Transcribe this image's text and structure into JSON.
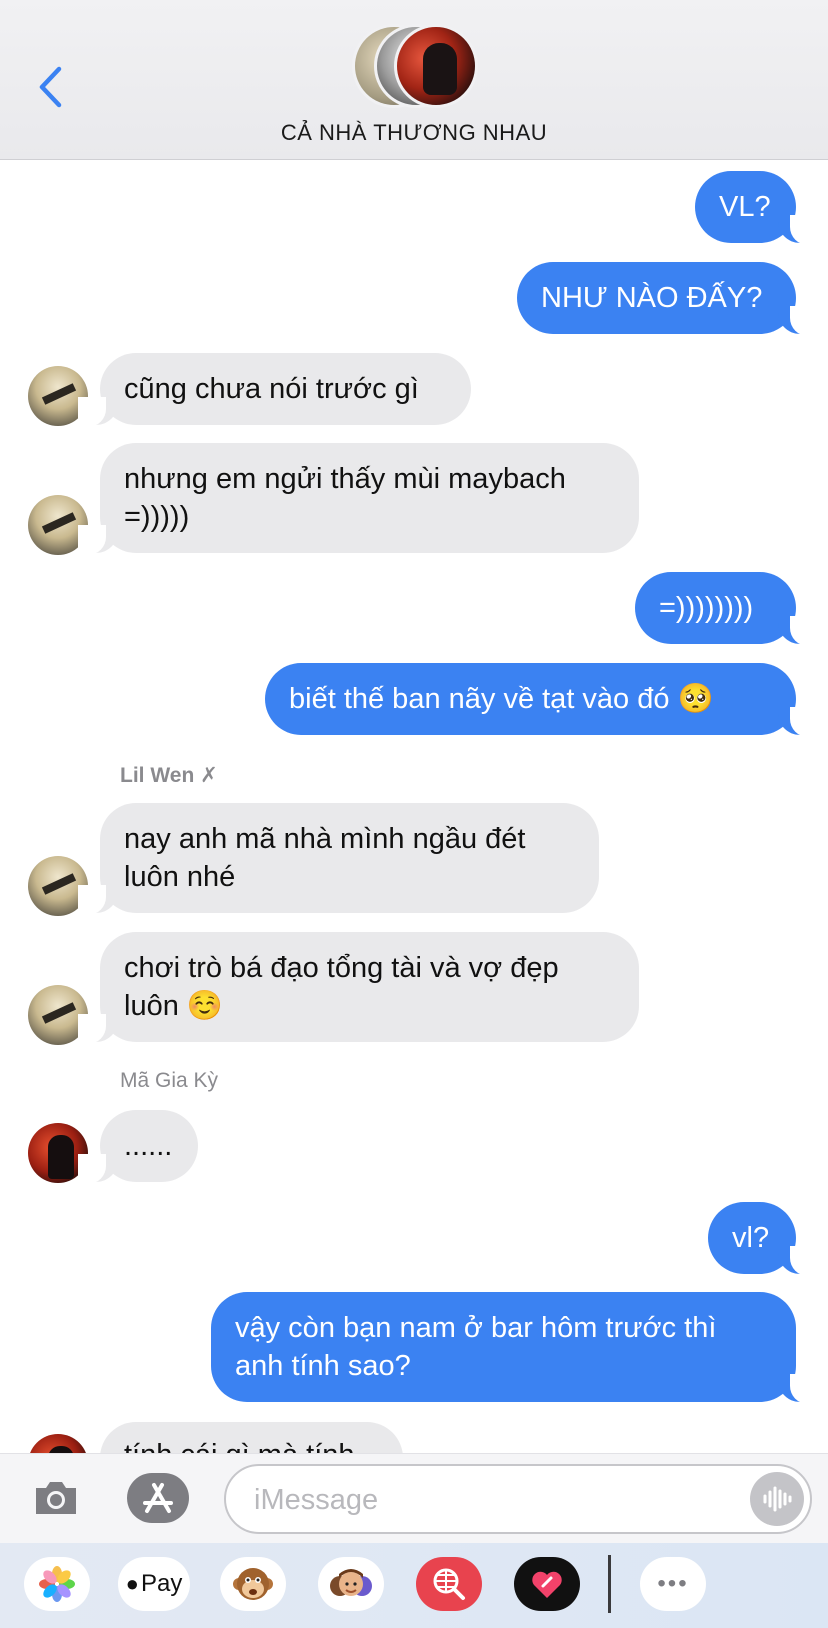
{
  "header": {
    "back_icon": "chevron-left-icon",
    "group_name": "CẢ NHÀ THƯƠNG NHAU",
    "accent_color": "#3b82f2"
  },
  "messages": [
    {
      "from": "me",
      "text": "VL?"
    },
    {
      "from": "me",
      "text": "NHƯ NÀO ĐẤY?"
    },
    {
      "from": "Lil Wen",
      "text": "cũng chưa nói trước gì"
    },
    {
      "from": "Lil Wen",
      "text_line1": "nhưng em ngửi thấy mùi maybach",
      "text_line2": "=)))))"
    },
    {
      "from": "me",
      "text": "=))))))))"
    },
    {
      "from": "me",
      "text": "biết thế ban nãy về tạt vào đó 🥺"
    },
    {
      "sender_label": "Lil Wen ✗"
    },
    {
      "from": "Lil Wen",
      "text_line1": "nay anh mã nhà mình ngầu đét",
      "text_line2": "luôn nhé"
    },
    {
      "from": "Lil Wen",
      "text_line1": "chơi trò bá đạo tổng tài và vợ đẹp",
      "text_line2": "luôn ☺️"
    },
    {
      "sender_label": "Mã Gia Kỳ"
    },
    {
      "from": "Mã Gia Kỳ",
      "text": "......"
    },
    {
      "from": "me",
      "text": "vl?"
    },
    {
      "from": "me",
      "text_line1": "vậy còn bạn nam ở bar hôm trước thì",
      "text_line2": "anh tính sao?"
    },
    {
      "from": "Mã Gia Kỳ",
      "text": "tính cái gì mà tính"
    }
  ],
  "input_bar": {
    "placeholder": "iMessage",
    "camera_icon": "camera-icon",
    "apps_icon": "app-store-icon",
    "audio_icon": "audio-waveform-icon"
  },
  "app_drawer": {
    "apps": [
      "Photos",
      "Apple Pay",
      "Animoji",
      "Memoji",
      "Search",
      "Digital Touch",
      "More"
    ],
    "pay_label": "Pay",
    "more_label": "•••"
  }
}
